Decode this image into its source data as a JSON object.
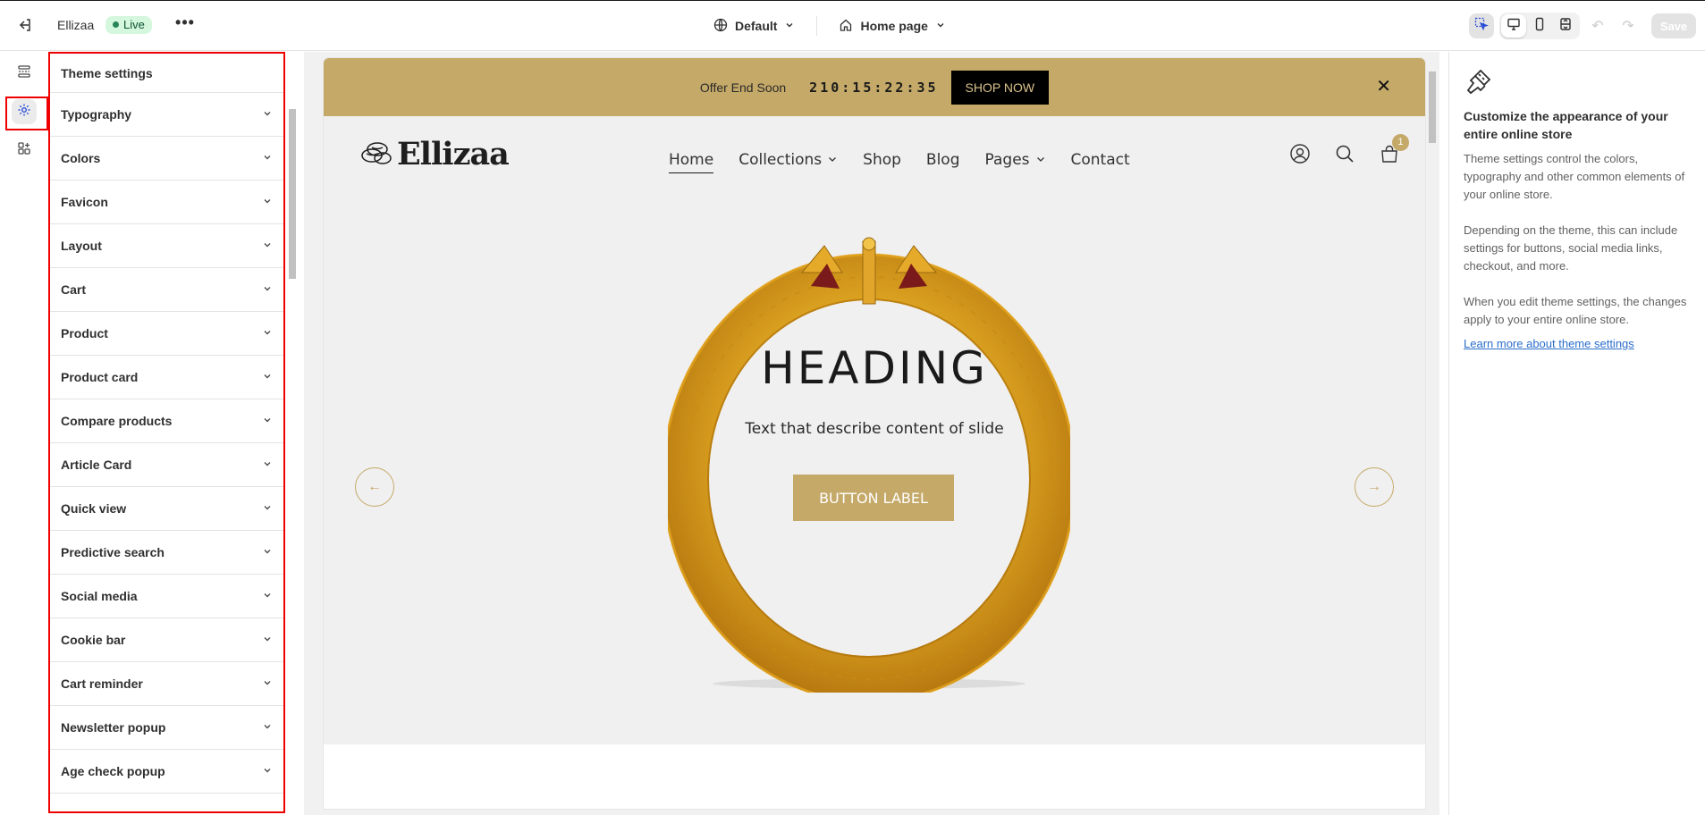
{
  "topbar": {
    "store_name": "Ellizaa",
    "status": "Live",
    "more": "•••",
    "theme_selector": "Default",
    "page_selector": "Home page",
    "save_label": "Save"
  },
  "panel": {
    "title": "Theme settings",
    "items": [
      "Typography",
      "Colors",
      "Favicon",
      "Layout",
      "Cart",
      "Product",
      "Product card",
      "Compare products",
      "Article Card",
      "Quick view",
      "Predictive search",
      "Social media",
      "Cookie bar",
      "Cart reminder",
      "Newsletter popup",
      "Age check popup"
    ]
  },
  "preview": {
    "announcement": {
      "text": "Offer End Soon",
      "countdown": "210:15:22:35",
      "button": "SHOP NOW",
      "close": "✕"
    },
    "logo": "Ellizaa",
    "nav": [
      "Home",
      "Collections",
      "Shop",
      "Blog",
      "Pages",
      "Contact"
    ],
    "cart_count": "1",
    "hero": {
      "heading": "HEADING",
      "subheading": "Text that describe content of slide",
      "button": "BUTTON LABEL"
    }
  },
  "info": {
    "title": "Customize the appearance of your entire online store",
    "p1": "Theme settings control the colors, typography and other common elements of your online store.",
    "p2": "Depending on the theme, this can include settings for buttons, social media links, checkout, and more.",
    "p3": "When you edit theme settings, the changes apply to your entire online store.",
    "link": "Learn more about theme settings"
  },
  "colors": {
    "accent_gold": "#c5a968",
    "highlight_red": "#e00000",
    "live_green": "#29845a"
  }
}
